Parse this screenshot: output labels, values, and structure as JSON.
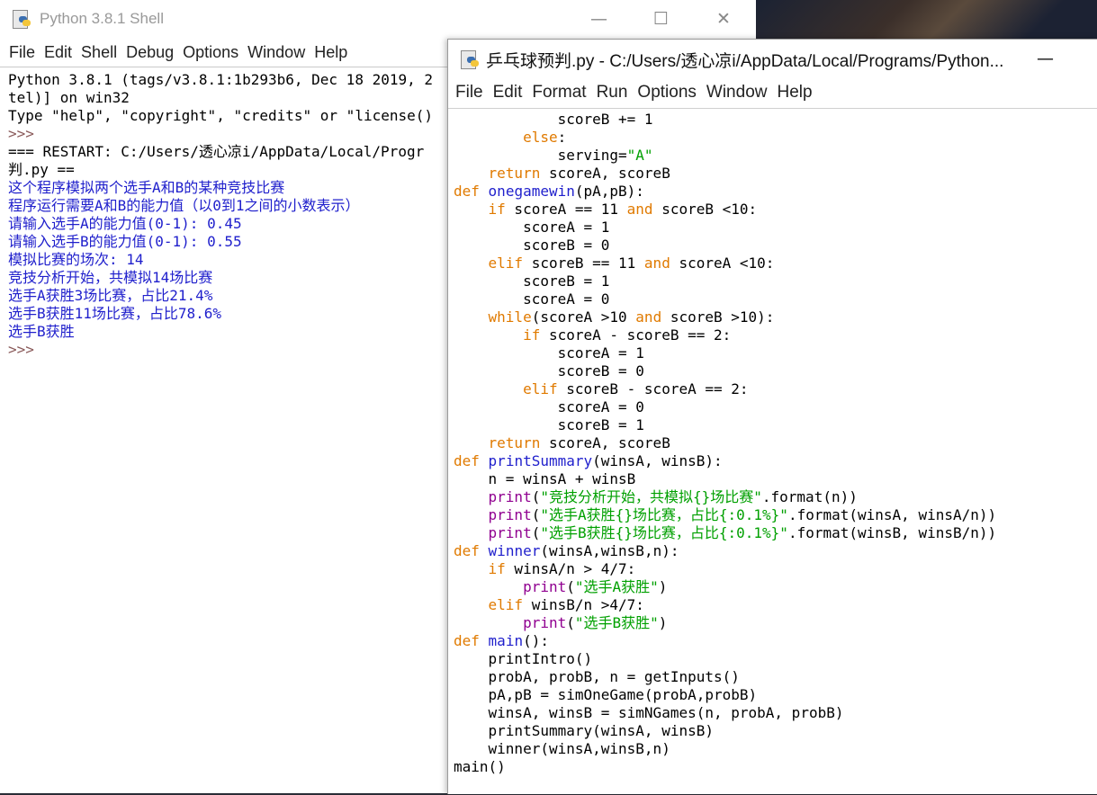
{
  "shell": {
    "title": "Python 3.8.1 Shell",
    "menu": [
      "File",
      "Edit",
      "Shell",
      "Debug",
      "Options",
      "Window",
      "Help"
    ],
    "lines": [
      {
        "t": "Python 3.8.1 (tags/v3.8.1:1b293b6, Dec 18 2019, 2",
        "c": "c-out"
      },
      {
        "t": "tel)] on win32",
        "c": "c-out"
      },
      {
        "t": "Type \"help\", \"copyright\", \"credits\" or \"license()",
        "c": "c-out"
      },
      {
        "t": ">>>",
        "c": "c-prompt"
      },
      {
        "t": "=== RESTART: C:/Users/透心凉i/AppData/Local/Progr",
        "c": "c-restart"
      },
      {
        "t": "判.py ==",
        "c": "c-restart"
      },
      {
        "t": "这个程序模拟两个选手A和B的某种竞技比赛",
        "c": "c-blue"
      },
      {
        "t": "程序运行需要A和B的能力值（以0到1之间的小数表示）",
        "c": "c-blue"
      },
      {
        "t": "请输入选手A的能力值(0-1): 0.45",
        "c": "c-blue"
      },
      {
        "t": "请输入选手B的能力值(0-1): 0.55",
        "c": "c-blue"
      },
      {
        "t": "模拟比赛的场次: 14",
        "c": "c-blue"
      },
      {
        "t": "竞技分析开始，共模拟14场比赛",
        "c": "c-blue"
      },
      {
        "t": "选手A获胜3场比赛，占比21.4%",
        "c": "c-blue"
      },
      {
        "t": "选手B获胜11场比赛，占比78.6%",
        "c": "c-blue"
      },
      {
        "t": "选手B获胜",
        "c": "c-blue"
      },
      {
        "t": ">>>",
        "c": "c-prompt"
      }
    ]
  },
  "editor": {
    "title": "乒乓球预判.py - C:/Users/透心凉i/AppData/Local/Programs/Python...",
    "menu": [
      "File",
      "Edit",
      "Format",
      "Run",
      "Options",
      "Window",
      "Help"
    ],
    "lines": [
      [
        [
          "            scoreB += 1",
          "dflt"
        ]
      ],
      [
        [
          "        ",
          "dflt"
        ],
        [
          "else",
          "kw"
        ],
        [
          ":",
          "dflt"
        ]
      ],
      [
        [
          "            serving=",
          "dflt"
        ],
        [
          "\"A\"",
          "str"
        ]
      ],
      [
        [
          "    ",
          "dflt"
        ],
        [
          "return",
          "kw"
        ],
        [
          " scoreA, scoreB",
          "dflt"
        ]
      ],
      [
        [
          "def",
          "kw"
        ],
        [
          " ",
          "dflt"
        ],
        [
          "onegamewin",
          "fn"
        ],
        [
          "(pA,pB):",
          "dflt"
        ]
      ],
      [
        [
          "    ",
          "dflt"
        ],
        [
          "if",
          "kw"
        ],
        [
          " scoreA == 11 ",
          "dflt"
        ],
        [
          "and",
          "kw"
        ],
        [
          " scoreB <10:",
          "dflt"
        ]
      ],
      [
        [
          "        scoreA = 1",
          "dflt"
        ]
      ],
      [
        [
          "        scoreB = 0",
          "dflt"
        ]
      ],
      [
        [
          "    ",
          "dflt"
        ],
        [
          "elif",
          "kw"
        ],
        [
          " scoreB == 11 ",
          "dflt"
        ],
        [
          "and",
          "kw"
        ],
        [
          " scoreA <10:",
          "dflt"
        ]
      ],
      [
        [
          "        scoreB = 1",
          "dflt"
        ]
      ],
      [
        [
          "        scoreA = 0",
          "dflt"
        ]
      ],
      [
        [
          "    ",
          "dflt"
        ],
        [
          "while",
          "kw"
        ],
        [
          "(scoreA >10 ",
          "dflt"
        ],
        [
          "and",
          "kw"
        ],
        [
          " scoreB >10):",
          "dflt"
        ]
      ],
      [
        [
          "        ",
          "dflt"
        ],
        [
          "if",
          "kw"
        ],
        [
          " scoreA - scoreB == 2:",
          "dflt"
        ]
      ],
      [
        [
          "            scoreA = 1",
          "dflt"
        ]
      ],
      [
        [
          "            scoreB = 0",
          "dflt"
        ]
      ],
      [
        [
          "        ",
          "dflt"
        ],
        [
          "elif",
          "kw"
        ],
        [
          " scoreB - scoreA == 2:",
          "dflt"
        ]
      ],
      [
        [
          "            scoreA = 0",
          "dflt"
        ]
      ],
      [
        [
          "            scoreB = 1",
          "dflt"
        ]
      ],
      [
        [
          "    ",
          "dflt"
        ],
        [
          "return",
          "kw"
        ],
        [
          " scoreA, scoreB",
          "dflt"
        ]
      ],
      [
        [
          "def",
          "kw"
        ],
        [
          " ",
          "dflt"
        ],
        [
          "printSummary",
          "fn"
        ],
        [
          "(winsA, winsB):",
          "dflt"
        ]
      ],
      [
        [
          "    n = winsA + winsB",
          "dflt"
        ]
      ],
      [
        [
          "    ",
          "dflt"
        ],
        [
          "print",
          "bi"
        ],
        [
          "(",
          "dflt"
        ],
        [
          "\"竞技分析开始，共模拟{}场比赛\"",
          "str"
        ],
        [
          ".format(n))",
          "dflt"
        ]
      ],
      [
        [
          "    ",
          "dflt"
        ],
        [
          "print",
          "bi"
        ],
        [
          "(",
          "dflt"
        ],
        [
          "\"选手A获胜{}场比赛，占比{:0.1%}\"",
          "str"
        ],
        [
          ".format(winsA, winsA/n))",
          "dflt"
        ]
      ],
      [
        [
          "    ",
          "dflt"
        ],
        [
          "print",
          "bi"
        ],
        [
          "(",
          "dflt"
        ],
        [
          "\"选手B获胜{}场比赛，占比{:0.1%}\"",
          "str"
        ],
        [
          ".format(winsB, winsB/n))",
          "dflt"
        ]
      ],
      [
        [
          "def",
          "kw"
        ],
        [
          " ",
          "dflt"
        ],
        [
          "winner",
          "fn"
        ],
        [
          "(winsA,winsB,n):",
          "dflt"
        ]
      ],
      [
        [
          "    ",
          "dflt"
        ],
        [
          "if",
          "kw"
        ],
        [
          " winsA/n > 4/7:",
          "dflt"
        ]
      ],
      [
        [
          "        ",
          "dflt"
        ],
        [
          "print",
          "bi"
        ],
        [
          "(",
          "dflt"
        ],
        [
          "\"选手A获胜\"",
          "str"
        ],
        [
          ")",
          "dflt"
        ]
      ],
      [
        [
          "    ",
          "dflt"
        ],
        [
          "elif",
          "kw"
        ],
        [
          " winsB/n >4/7:",
          "dflt"
        ]
      ],
      [
        [
          "        ",
          "dflt"
        ],
        [
          "print",
          "bi"
        ],
        [
          "(",
          "dflt"
        ],
        [
          "\"选手B获胜\"",
          "str"
        ],
        [
          ")",
          "dflt"
        ]
      ],
      [
        [
          "def",
          "kw"
        ],
        [
          " ",
          "dflt"
        ],
        [
          "main",
          "fn"
        ],
        [
          "():",
          "dflt"
        ]
      ],
      [
        [
          "    printIntro()",
          "dflt"
        ]
      ],
      [
        [
          "    probA, probB, n = getInputs()",
          "dflt"
        ]
      ],
      [
        [
          "    pA,pB = simOneGame(probA,probB)",
          "dflt"
        ]
      ],
      [
        [
          "    winsA, winsB = simNGames(n, probA, probB)",
          "dflt"
        ]
      ],
      [
        [
          "    printSummary(winsA, winsB)",
          "dflt"
        ]
      ],
      [
        [
          "    winner(winsA,winsB,n)",
          "dflt"
        ]
      ],
      [
        [
          "main()",
          "dflt"
        ]
      ]
    ]
  },
  "window_controls": {
    "minimize": "—",
    "maximize": "☐",
    "close": "✕"
  }
}
